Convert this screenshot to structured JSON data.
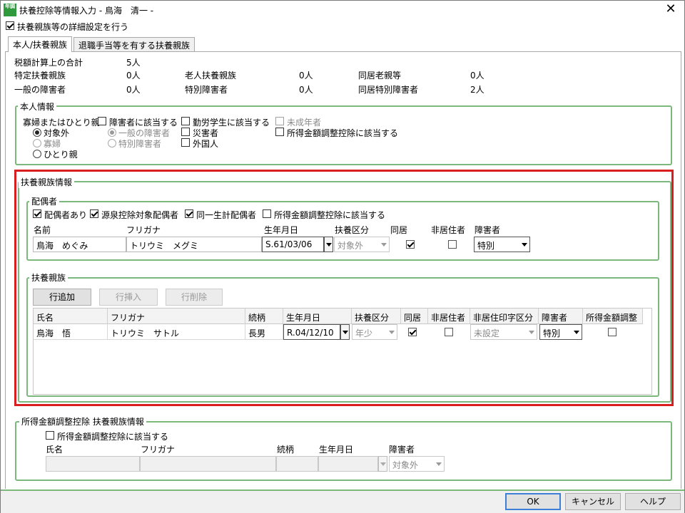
{
  "window": {
    "title": "扶養控除等情報入力 - 鳥海　清一 -",
    "app_icon_text": "年調"
  },
  "detail_setting": {
    "label": "扶養親族等の詳細設定を行う",
    "checked": true
  },
  "tabs": [
    {
      "label": "本人/扶養親族",
      "active": true
    },
    {
      "label": "退職手当等を有する扶養親族",
      "active": false
    }
  ],
  "summary": {
    "tax_total_label": "税額計算上の合計",
    "tax_total_value": "5人",
    "specific_label": "特定扶養親族",
    "specific_value": "0人",
    "elderly_label": "老人扶養親族",
    "elderly_value": "0人",
    "cohabit_elderly_label": "同居老親等",
    "cohabit_elderly_value": "0人",
    "general_disabled_label": "一般の障害者",
    "general_disabled_value": "0人",
    "special_disabled_label": "特別障害者",
    "special_disabled_value": "0人",
    "cohabit_special_label": "同居特別障害者",
    "cohabit_special_value": "2人"
  },
  "self_info": {
    "group_title": "本人情報",
    "widow_label": "寡婦またはひとり親",
    "widow_options": [
      "対象外",
      "寡婦",
      "ひとり親"
    ],
    "disabled_label": "障害者に該当する",
    "disabled_options": [
      "一般の障害者",
      "特別障害者"
    ],
    "student_label": "勤労学生に該当する",
    "disaster_label": "災害者",
    "foreigner_label": "外国人",
    "minor_label": "未成年者",
    "income_adjust_label": "所得金額調整控除に該当する"
  },
  "dependents_info": {
    "group_title": "扶養親族情報",
    "spouse": {
      "group_title": "配偶者",
      "has_spouse_label": "配偶者あり",
      "withholding_label": "源泉控除対象配偶者",
      "same_household_label": "同一生計配偶者",
      "income_adjust_label": "所得金額調整控除に該当する",
      "headers": {
        "name": "名前",
        "furigana": "フリガナ",
        "birth": "生年月日",
        "category": "扶養区分",
        "cohabit": "同居",
        "nonresident": "非居住者",
        "disability": "障害者"
      },
      "row": {
        "name": "鳥海　めぐみ",
        "furigana": "トリウミ　メグミ",
        "birth": "S.61/03/06",
        "category": "対象外",
        "disability": "特別"
      }
    },
    "relatives": {
      "group_title": "扶養親族",
      "add_row": "行追加",
      "insert_row": "行挿入",
      "delete_row": "行削除",
      "headers": [
        "氏名",
        "フリガナ",
        "続柄",
        "生年月日",
        "扶養区分",
        "同居",
        "非居住者",
        "非居住印字区分",
        "障害者",
        "所得金額調整"
      ],
      "rows": [
        {
          "name": "鳥海　悟",
          "furigana": "トリウミ　サトル",
          "relation": "長男",
          "birth": "R.04/12/10",
          "category": "年少",
          "nonres_print": "未設定",
          "disability": "特別"
        }
      ]
    }
  },
  "income_adjust_section": {
    "group_title": "所得金額調整控除 扶養親族情報",
    "applies_label": "所得金額調整控除に該当する",
    "headers": {
      "name": "氏名",
      "furigana": "フリガナ",
      "relation": "続柄",
      "birth": "生年月日",
      "disability": "障害者"
    },
    "disability_value": "対象外"
  },
  "footer": {
    "ok": "OK",
    "cancel": "キャンセル",
    "help": "ヘルプ"
  },
  "colors": {
    "group_border": "#7cb87c",
    "highlight": "#d81e1e",
    "ok_border": "#3c7fd6"
  }
}
